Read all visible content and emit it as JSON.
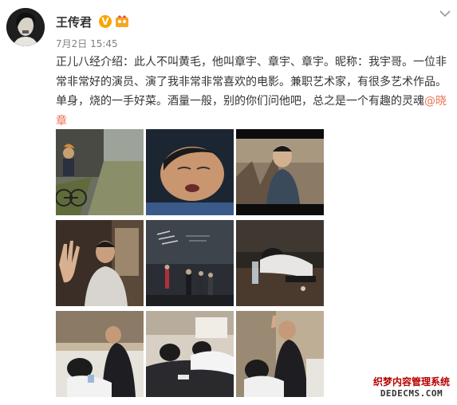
{
  "post": {
    "author": "王传君",
    "verified_badge": "V",
    "date": "7月2日 15:45",
    "text_main": "正儿八经介绍：此人不叫黄毛，他叫章宇、章宇、章宇。昵称：我宇哥。一位非常非常好的演员、演了我非常非常喜欢的电影。兼职艺术家，有很多艺术作品。单身，烧的一手好菜。酒量一般，别的你们问他吧，总之是一个有趣的灵魂",
    "mention": "@晓章"
  },
  "colors": {
    "text": "#333333",
    "meta": "#808080",
    "mention": "#eb7350",
    "verified": "#f7a600",
    "watermark_red": "#b80000"
  },
  "icons": [
    "avatar",
    "verified-badge-icon",
    "member-icon",
    "chevron-down-icon"
  ],
  "photos": [
    {
      "label": "photo-bike-street"
    },
    {
      "label": "photo-sleeping-face"
    },
    {
      "label": "photo-movie-still"
    },
    {
      "label": "photo-hand-raised"
    },
    {
      "label": "photo-movie-poster"
    },
    {
      "label": "photo-table-sleeping"
    },
    {
      "label": "photo-bed-1"
    },
    {
      "label": "photo-bed-2"
    },
    {
      "label": "photo-bed-3"
    }
  ],
  "watermark": {
    "line1": "织梦内容管理系统",
    "line2": "DEDECMS.COM"
  }
}
